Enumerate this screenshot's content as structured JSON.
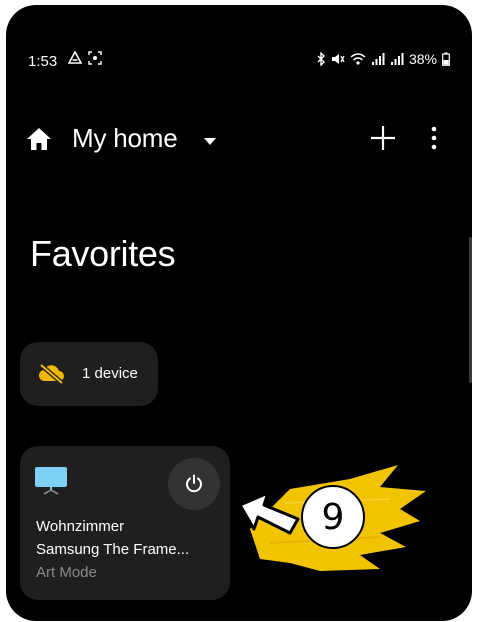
{
  "status_bar": {
    "time": "1:53",
    "battery_text": "38%",
    "icons": [
      "drive-icon",
      "screenshot-icon",
      "bluetooth-icon",
      "mute-icon",
      "wifi-icon",
      "signal-icon",
      "signal-icon",
      "battery-icon"
    ]
  },
  "header": {
    "title": "My home",
    "icons": [
      "home-icon",
      "dropdown-icon",
      "plus-icon",
      "more-vert-icon"
    ]
  },
  "favorites": {
    "title": "Favorites",
    "offline_chip": {
      "label": "1 device",
      "icon": "cloud-off-icon",
      "icon_color": "#f2b705"
    },
    "device_card": {
      "room": "Wohnzimmer",
      "name": "Samsung The Frame...",
      "status": "Art Mode",
      "icon": "tv-icon",
      "action_icon": "power-icon"
    }
  },
  "annotation": {
    "step_number": "9",
    "highlight_color": "#f2c300",
    "icon": "arrow-left-icon"
  },
  "colors": {
    "background": "#000000",
    "card": "#1f1f1f",
    "text_primary": "#ffffff",
    "text_secondary": "#8a8a8a"
  }
}
